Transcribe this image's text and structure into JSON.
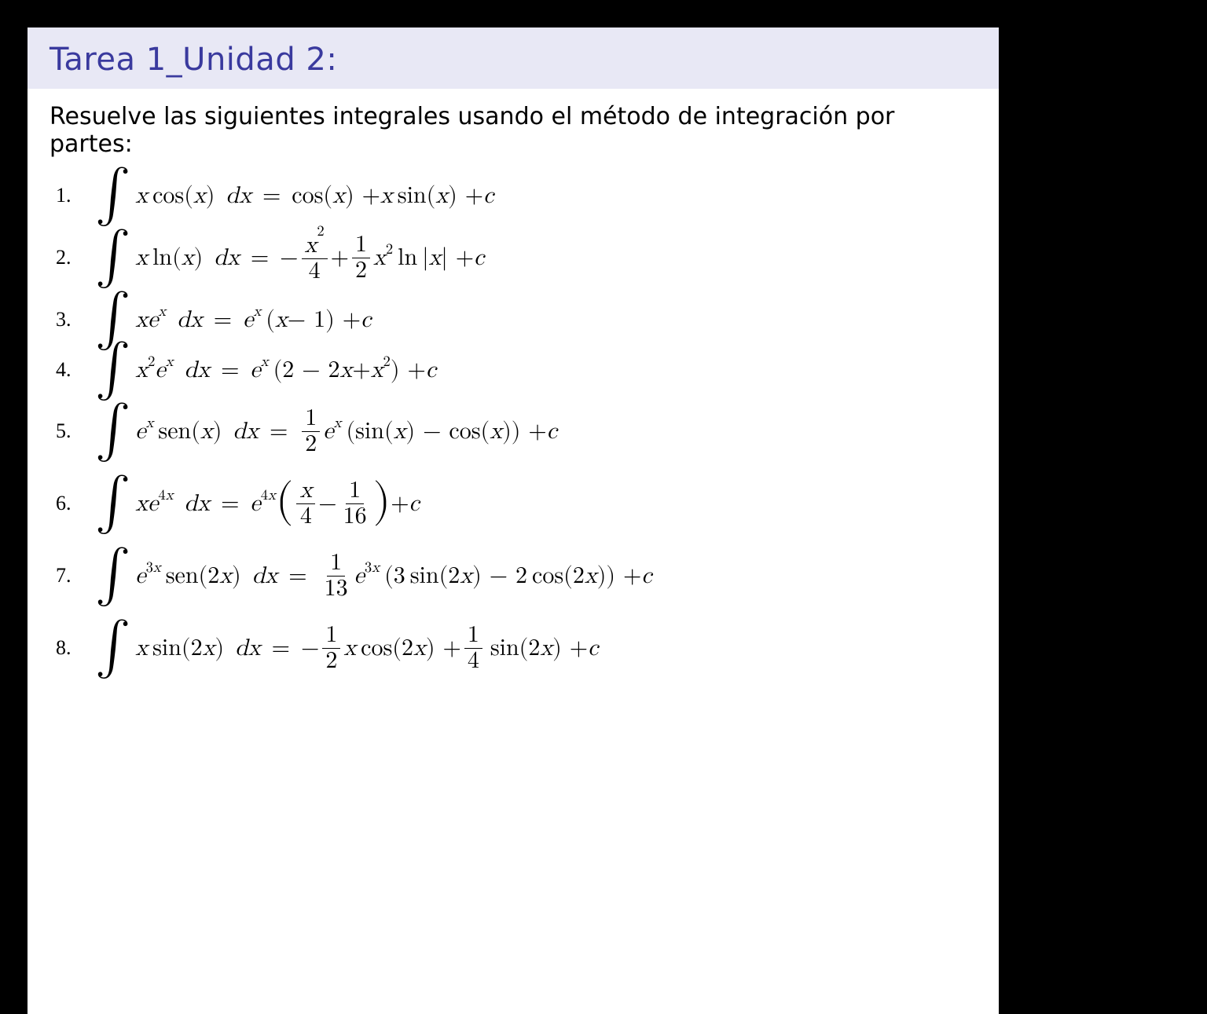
{
  "title": "Tarea 1_Unidad 2:",
  "subtitle": "Resuelve las siguientes integrales usando el método de integración por partes:",
  "items": [
    {
      "n": "1.",
      "integrand": "x cos(x) dx",
      "result": "cos(x) + x sin(x) + c",
      "tex": "\\int x\\cos(x)\\,dx = \\cos(x)+x\\sin(x)+c"
    },
    {
      "n": "2.",
      "integrand": "x ln(x) dx",
      "result": "-x^2/4 + (1/2) x^2 ln|x| + c",
      "tex": "\\int x\\ln(x)\\,dx = -\\frac{x^{2}}{4}+\\frac{1}{2}x^{2}\\ln|x|+c"
    },
    {
      "n": "3.",
      "integrand": "x e^x dx",
      "result": "e^x (x - 1) + c",
      "tex": "\\int x e^{x}\\,dx = e^{x}(x-1)+c"
    },
    {
      "n": "4.",
      "integrand": "x^2 e^x dx",
      "result": "e^x (2 - 2x + x^2) + c",
      "tex": "\\int x^{2} e^{x}\\,dx = e^{x}(2-2x+x^{2})+c"
    },
    {
      "n": "5.",
      "integrand": "e^x sen(x) dx",
      "result": "(1/2) e^x (sin(x) - cos(x)) + c",
      "tex": "\\int e^{x}\\operatorname{sen}(x)\\,dx = \\frac{1}{2}e^{x}(\\sin(x)-\\cos(x))+c"
    },
    {
      "n": "6.",
      "integrand": "x e^{4x} dx",
      "result": "e^{4x} (x/4 - 1/16) + c",
      "tex": "\\int x e^{4x}\\,dx = e^{4x}\\left(\\frac{x}{4}-\\frac{1}{16}\\right)+c"
    },
    {
      "n": "7.",
      "integrand": "e^{3x} sen(2x) dx",
      "result": "(1/13) e^{3x} (3 sin(2x) - 2 cos(2x)) + c",
      "tex": "\\int e^{3x}\\operatorname{sen}(2x)\\,dx = \\frac{1}{13}e^{3x}(3\\sin(2x)-2\\cos(2x))+c"
    },
    {
      "n": "8.",
      "integrand": "x sin(2x) dx",
      "result": "-(1/2) x cos(2x) + (1/4) sin(2x) + c",
      "tex": "\\int x\\sin(2x)\\,dx = -\\frac{1}{2}x\\cos(2x)+\\frac{1}{4}\\sin(2x)+c"
    }
  ]
}
